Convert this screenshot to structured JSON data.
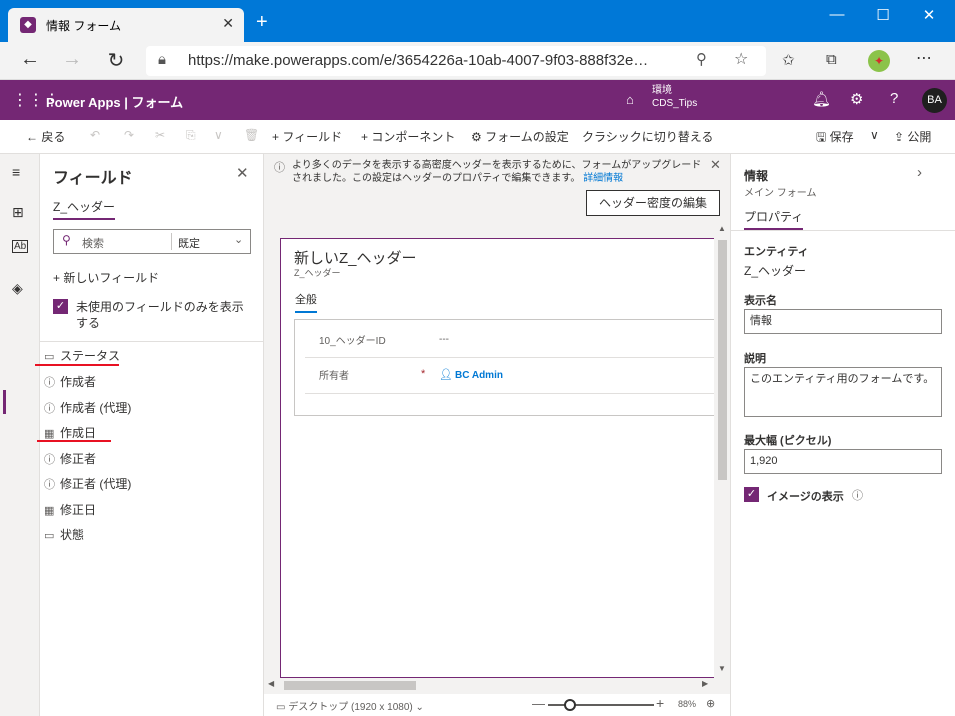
{
  "browser": {
    "tab_title": "情報 フォーム",
    "url": "https://make.powerapps.com/e/3654226a-10ab-4007-9f03-888f32e…"
  },
  "app": {
    "title": "Power Apps  |  フォーム",
    "env_label": "環境",
    "env_name": "CDS_Tips",
    "avatar": "BA",
    "accent": "#742774"
  },
  "commands": {
    "back": "戻る",
    "add_field": "フィールド",
    "add_component": "コンポーネント",
    "form_settings": "フォームの設定",
    "switch_classic": "クラシックに切り替える",
    "save": "保存",
    "publish": "公開"
  },
  "field_panel": {
    "title": "フィールド",
    "entity_tab": "Z_ヘッダー",
    "search_placeholder": "検索",
    "filter_value": "既定",
    "new_field": "新しいフィールド",
    "show_unused": "未使用のフィールドのみを表示する",
    "fields": [
      "ステータス",
      "作成者",
      "作成者 (代理)",
      "作成日",
      "修正者",
      "修正者 (代理)",
      "修正日",
      "状態"
    ]
  },
  "banner": {
    "text": "より多くのデータを表示する高密度ヘッダーを表示するために、フォームがアップグレードされました。この設定はヘッダーのプロパティで編集できます。",
    "link": "詳細情報",
    "edit_button": "ヘッダー密度の編集"
  },
  "form": {
    "title": "新しいZ_ヘッダー",
    "subtitle": "Z_ヘッダー",
    "tab": "全般",
    "rows": [
      {
        "label": "10_ヘッダーID",
        "value": "---"
      },
      {
        "label": "所有者",
        "value": "BC Admin"
      }
    ]
  },
  "status": {
    "view": "デスクトップ (1920 x 1080)",
    "zoom": "88%"
  },
  "properties": {
    "title": "情報",
    "subtitle": "メイン フォーム",
    "tab": "プロパティ",
    "entity_label": "エンティティ",
    "entity_value": "Z_ヘッダー",
    "display_name_label": "表示名",
    "display_name_value": "情報",
    "description_label": "説明",
    "description_value": "このエンティティ用のフォームです。",
    "max_width_label": "最大幅 (ピクセル)",
    "max_width_value": "1,920",
    "show_image_label": "イメージの表示"
  }
}
